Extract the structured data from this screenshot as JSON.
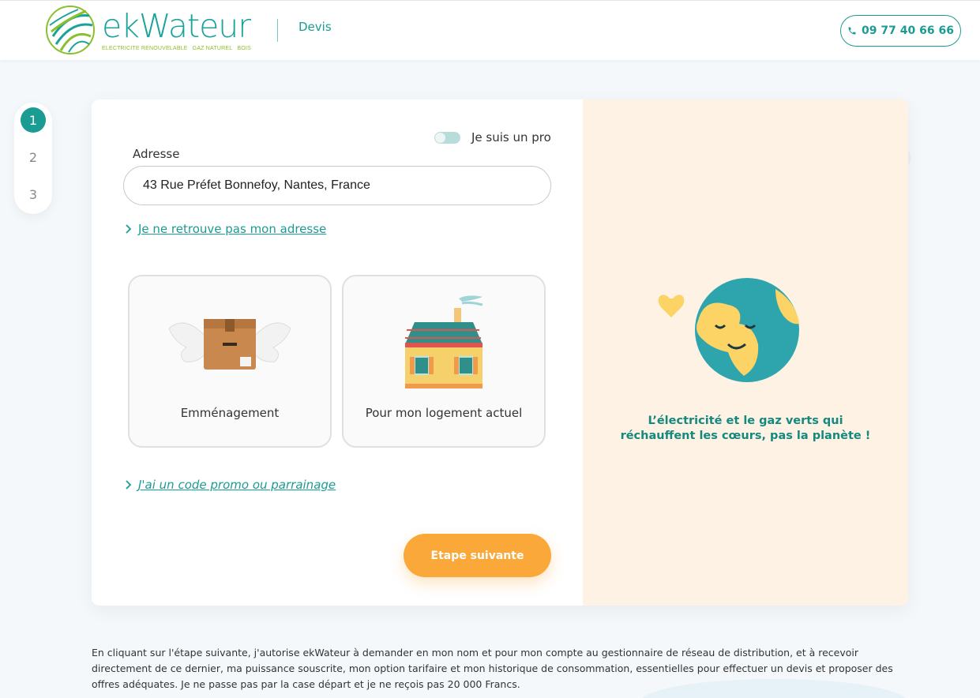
{
  "header": {
    "logo_word": "ekWateur",
    "logo_tag": [
      "ELECTRICITE RENOUVELABLE",
      "GAZ NATUREL",
      "BOIS"
    ],
    "section": "Devis",
    "phone": "09 77 40 66 66"
  },
  "steps": [
    {
      "label": "1",
      "active": true
    },
    {
      "label": "2",
      "active": false
    },
    {
      "label": "3",
      "active": false
    }
  ],
  "form": {
    "pro_toggle_label": "Je suis un pro",
    "pro_toggle_on": false,
    "address_label": "Adresse",
    "address_value": "43 Rue Préfet Bonnefoy, Nantes, France",
    "no_address_link": "Je ne retrouve pas mon adresse",
    "choices": [
      {
        "label": "Emménagement",
        "icon": "flying-box-icon"
      },
      {
        "label": "Pour mon logement actuel",
        "icon": "house-icon"
      }
    ],
    "promo_link": "J'ai un code promo ou parrainage",
    "next_button": "Etape suivante"
  },
  "aside": {
    "tagline_line1": "L’électricité et le gaz verts qui",
    "tagline_line2": "réchauffent les cœurs, pas la planète !",
    "icon": "happy-earth-icon"
  },
  "legal": "En cliquant sur l'étape suivante, j'autorise ekWateur à demander en mon nom et pour mon compte au gestionnaire de réseau de distribution, et à recevoir directement de ce dernier, ma puissance souscrite, mon option tarifaire et mon historique de consommation, essentielles pour effectuer un devis et proposer des offres adéquates. Je ne passe pas par la case départ et je ne reçois pas 20 000 Francs.",
  "colors": {
    "brand_teal": "#1a9c92",
    "accent_orange": "#fba83a",
    "aside_bg": "#fdf2e3",
    "logo_green": "#8bbf2b"
  }
}
